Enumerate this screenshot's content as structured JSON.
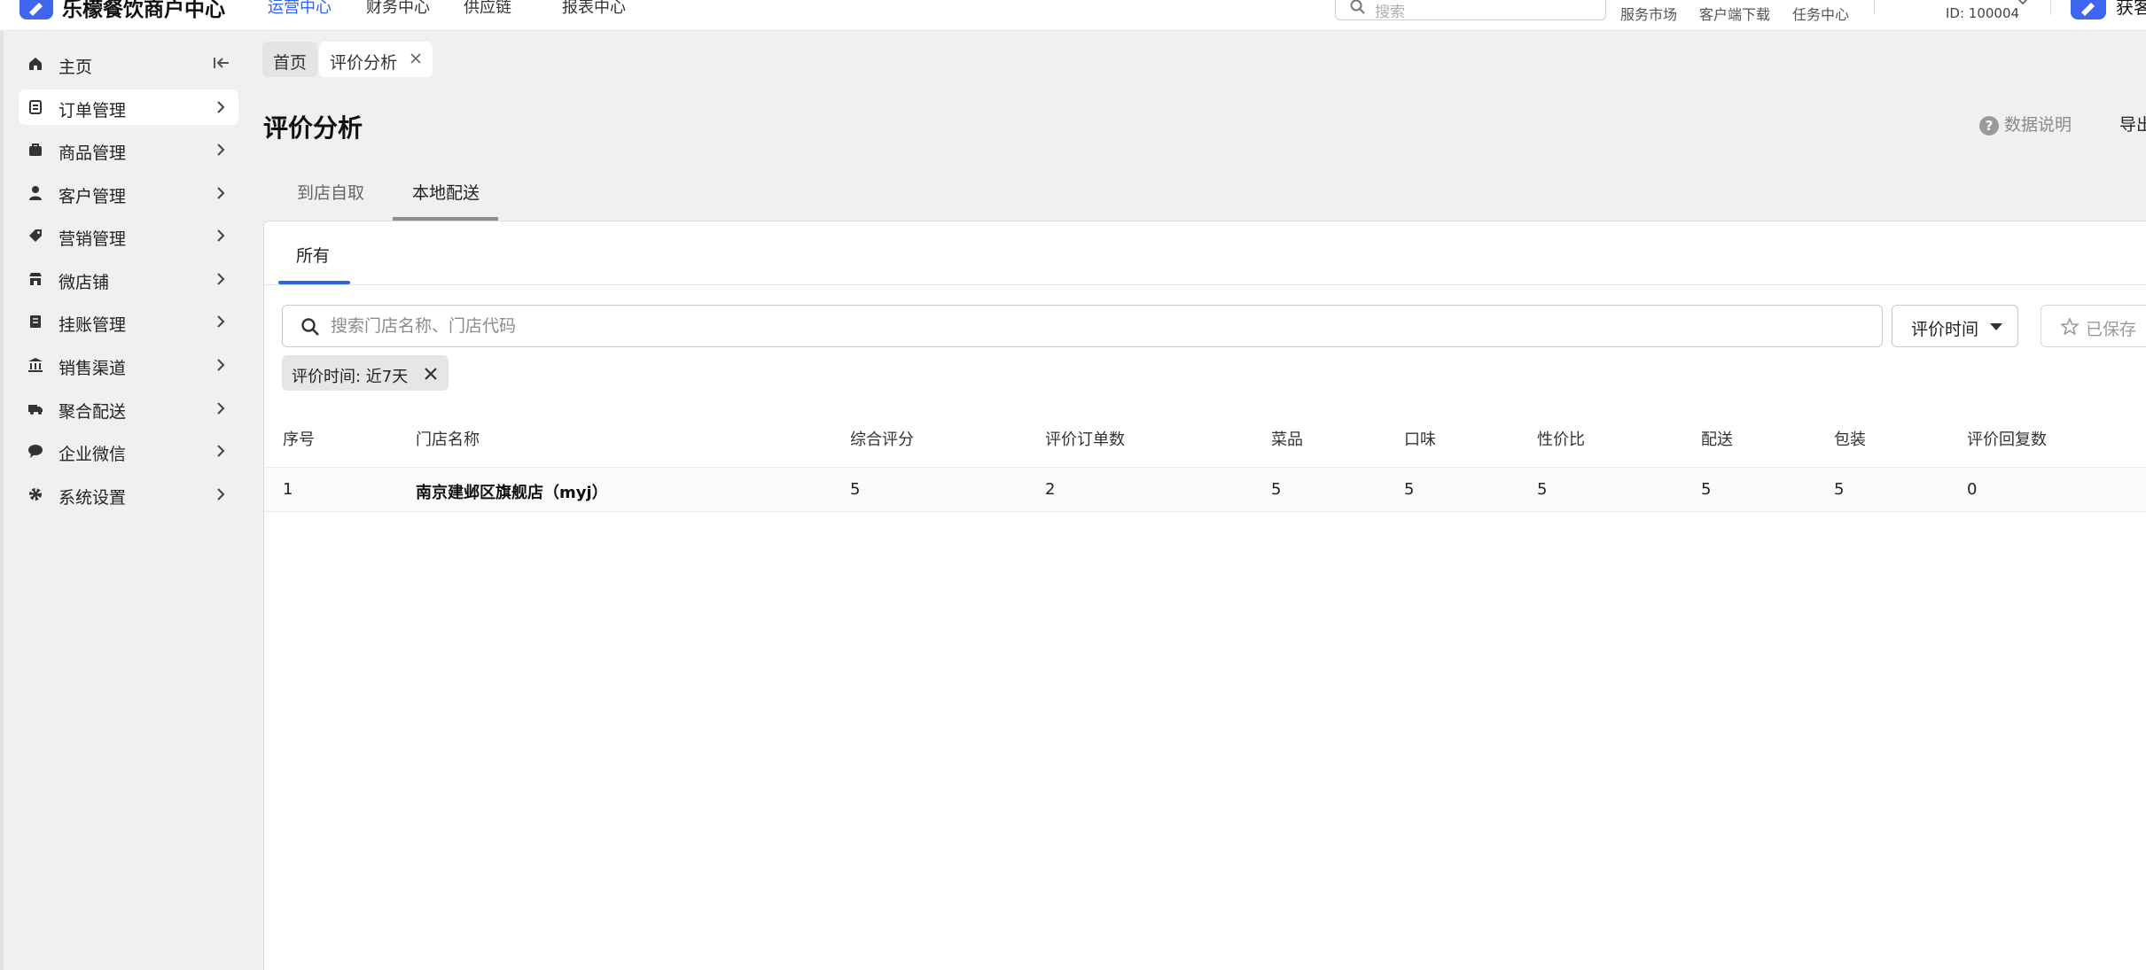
{
  "header": {
    "app_title": "乐檬餐饮商户中心",
    "nav": [
      {
        "label": "运营中心",
        "active": true
      },
      {
        "label": "财务中心",
        "active": false
      },
      {
        "label": "供应链",
        "active": false
      },
      {
        "label": "报表中心",
        "active": false
      }
    ],
    "search_placeholder": "搜索",
    "links": [
      "服务市场",
      "客户端下载",
      "任务中心"
    ],
    "store_id": "ID: 100004",
    "user_name": "获客"
  },
  "sidebar": {
    "items": [
      {
        "label": "主页",
        "icon": "home-icon",
        "active": false
      },
      {
        "label": "订单管理",
        "icon": "order-icon",
        "active": true
      },
      {
        "label": "商品管理",
        "icon": "goods-icon",
        "active": false
      },
      {
        "label": "客户管理",
        "icon": "customer-icon",
        "active": false
      },
      {
        "label": "营销管理",
        "icon": "tag-icon",
        "active": false
      },
      {
        "label": "微店铺",
        "icon": "store-icon",
        "active": false
      },
      {
        "label": "挂账管理",
        "icon": "ledger-icon",
        "active": false
      },
      {
        "label": "销售渠道",
        "icon": "bank-icon",
        "active": false
      },
      {
        "label": "聚合配送",
        "icon": "truck-icon",
        "active": false
      },
      {
        "label": "企业微信",
        "icon": "chat-icon",
        "active": false
      },
      {
        "label": "系统设置",
        "icon": "gear-icon",
        "active": false
      }
    ]
  },
  "breadcrumbs": {
    "home": "首页",
    "current": "评价分析"
  },
  "page": {
    "title": "评价分析",
    "data_help": "数据说明",
    "export": "导出"
  },
  "tabs": [
    {
      "label": "到店自取",
      "active": false
    },
    {
      "label": "本地配送",
      "active": true
    }
  ],
  "subtabs": [
    {
      "label": "所有",
      "active": true
    }
  ],
  "filters": {
    "search_placeholder": "搜索门店名称、门店代码",
    "time_button": "评价时间",
    "saved_button": "已保存",
    "chip": "评价时间: 近7天"
  },
  "table": {
    "columns": [
      "序号",
      "门店名称",
      "综合评分",
      "评价订单数",
      "菜品",
      "口味",
      "性价比",
      "配送",
      "包装",
      "评价回复数"
    ],
    "rows": [
      [
        "1",
        "南京建邺区旗舰店（myj）",
        "5",
        "2",
        "5",
        "5",
        "5",
        "5",
        "5",
        "0"
      ]
    ]
  },
  "colors": {
    "accent": "#2f63e8",
    "brand": "#4066f0",
    "background": "#f0f0f0"
  }
}
